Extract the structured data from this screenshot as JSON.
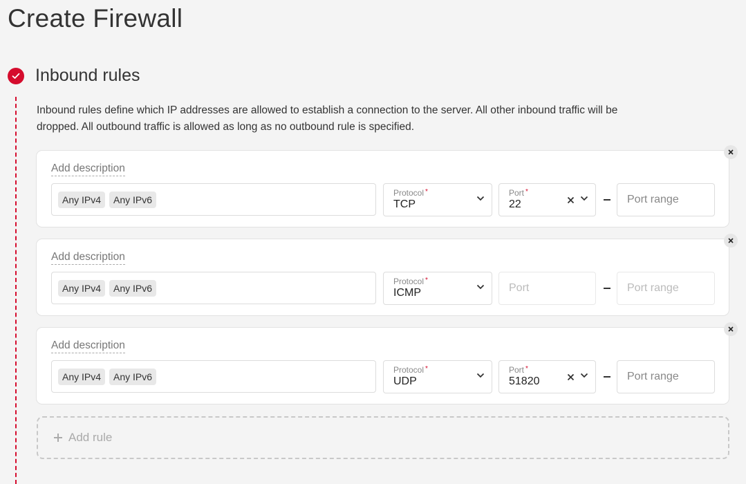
{
  "page": {
    "title": "Create Firewall"
  },
  "section": {
    "title": "Inbound rules",
    "description": "Inbound rules define which IP addresses are allowed to establish a connection to the server. All other inbound traffic will be dropped. All outbound traffic is allowed as long as no outbound rule is specified.",
    "accent_color": "#d50c2d"
  },
  "labels": {
    "add_description": "Add description",
    "protocol": "Protocol",
    "port": "Port",
    "required_marker": "*",
    "port_placeholder": "Port",
    "port_range_placeholder": "Port range"
  },
  "rules": [
    {
      "sources": [
        "Any IPv4",
        "Any IPv6"
      ],
      "protocol": "TCP",
      "port": "22"
    },
    {
      "sources": [
        "Any IPv4",
        "Any IPv6"
      ],
      "protocol": "ICMP",
      "port": ""
    },
    {
      "sources": [
        "Any IPv4",
        "Any IPv6"
      ],
      "protocol": "UDP",
      "port": "51820"
    }
  ],
  "add_rule": {
    "label": "Add rule"
  }
}
